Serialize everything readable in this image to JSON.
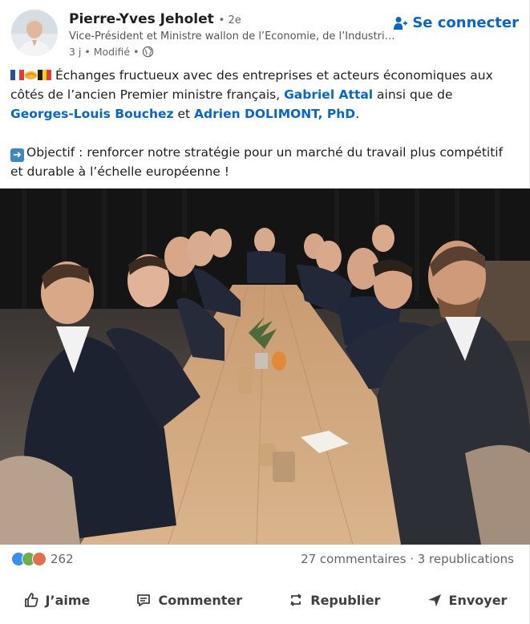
{
  "author": {
    "name": "Pierre-Yves Jeholet",
    "degree": "• 2e",
    "headline": "Vice-Président et Ministre wallon de l’Économie, de l’Industrie, du Numérique",
    "time": "3 j • Modifié •",
    "connect_label": "Se connecter"
  },
  "post": {
    "p1_prefix": "Échanges fructueux avec des entreprises et acteurs économiques aux côtés de l’ancien Premier ministre français, ",
    "mention1": "Gabriel Attal",
    "p1_mid": " ainsi que de ",
    "mention2": "Georges-Louis Bouchez",
    "p1_and": " et ",
    "mention3": "Adrien DOLIMONT, PhD",
    "p1_end": ".",
    "p2": "Objectif : renforcer notre stratégie pour un marché du travail plus compétitif et durable à l’échelle européenne !"
  },
  "social": {
    "reaction_count": "262",
    "stats": "27 commentaires · 3 republications"
  },
  "actions": {
    "like": "J’aime",
    "comment": "Commenter",
    "repost": "Republier",
    "send": "Envoyer"
  },
  "colors": {
    "accent": "#0a66c2",
    "text": "#1f1f1f",
    "muted": "#666666"
  },
  "icons": [
    "add-user-icon",
    "globe-icon",
    "like-icon",
    "comment-icon",
    "repost-icon",
    "send-icon"
  ]
}
